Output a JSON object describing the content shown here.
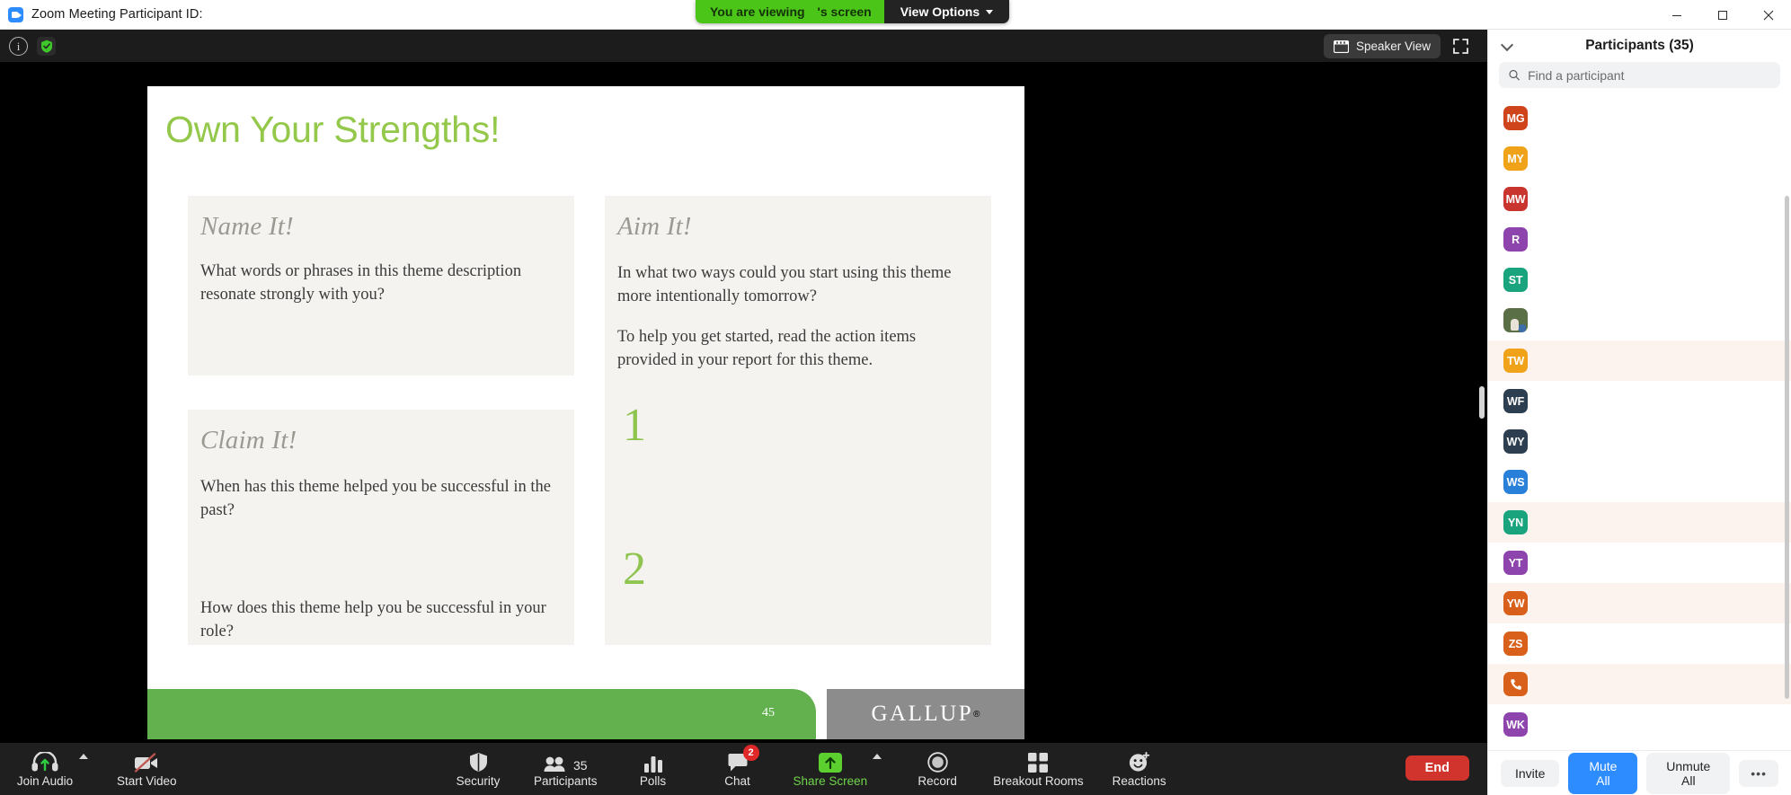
{
  "titlebar": {
    "app_title": "Zoom Meeting Participant ID:",
    "logo_icon": "zoom-logo-icon",
    "minimize_icon": "minimize-icon",
    "maximize_icon": "maximize-icon",
    "close_icon": "close-icon"
  },
  "share_banner": {
    "viewing_label": "You are viewing",
    "screen_owner_label": "'s screen",
    "view_options_label": "View Options",
    "caret_icon": "chevron-down-icon",
    "green": "#4bc517"
  },
  "meeting_top": {
    "info_icon": "info-icon",
    "encryption_icon": "shield-check-icon",
    "speaker_view_label": "Speaker View",
    "speaker_view_icon": "grid-view-icon",
    "fullscreen_icon": "fullscreen-expand-icon"
  },
  "slide": {
    "title": "Own Your Strengths!",
    "title_color": "#94c84b",
    "cards": [
      {
        "heading": "Name It!",
        "paragraphs": [
          "What words or phrases in this theme description resonate strongly with you?"
        ]
      },
      {
        "heading": "Claim It!",
        "paragraphs": [
          "When has this theme helped you be successful in the past?",
          "How does this theme help you be successful in your role?"
        ]
      },
      {
        "heading": "Aim It!",
        "paragraphs": [
          "In what two ways could you start using this theme more intentionally tomorrow?",
          "To help you get started, read the action items provided in your report for this theme."
        ],
        "numbers": [
          "1",
          "2"
        ]
      }
    ],
    "page_number": "45",
    "brand": "GALLUP",
    "brand_mark": "®",
    "footer_color": "#62b14e",
    "logo_block_color": "#8c8c8c"
  },
  "bottombar": {
    "left": [
      {
        "label": "Join Audio",
        "icon": "headset-join-audio-icon",
        "has_caret": true
      },
      {
        "label": "Start Video",
        "icon": "video-off-icon",
        "has_caret": false
      }
    ],
    "center": [
      {
        "label": "Security",
        "icon": "shield-icon"
      },
      {
        "label": "Participants",
        "icon": "participants-icon",
        "count": "35"
      },
      {
        "label": "Polls",
        "icon": "poll-bars-icon"
      },
      {
        "label": "Chat",
        "icon": "chat-bubble-icon",
        "badge": "2"
      },
      {
        "label": "Share Screen",
        "icon": "share-screen-icon",
        "has_caret": true,
        "green": true
      },
      {
        "label": "Record",
        "icon": "record-circle-icon"
      },
      {
        "label": "Breakout Rooms",
        "icon": "breakout-rooms-icon"
      },
      {
        "label": "Reactions",
        "icon": "reactions-smiley-icon"
      }
    ],
    "end_label": "End",
    "end_color": "#d0342c"
  },
  "panel": {
    "title": "Participants (35)",
    "collapse_icon": "chevron-down-icon",
    "search": {
      "placeholder": "Find a participant",
      "value": "",
      "icon": "search-icon"
    },
    "participants": [
      {
        "initials": "MG",
        "color": "#d0441b",
        "type": "initials",
        "highlight": false
      },
      {
        "initials": "MY",
        "color": "#f0a219",
        "type": "initials",
        "highlight": false
      },
      {
        "initials": "MW",
        "color": "#c9352e",
        "type": "initials",
        "highlight": false
      },
      {
        "initials": "R",
        "color": "#8e44ad",
        "type": "initials",
        "highlight": false
      },
      {
        "initials": "ST",
        "color": "#1aa47e",
        "type": "initials",
        "highlight": false
      },
      {
        "initials": "",
        "color": "#5b6f47",
        "type": "photo",
        "highlight": false
      },
      {
        "initials": "TW",
        "color": "#f0a219",
        "type": "initials",
        "highlight": true
      },
      {
        "initials": "WF",
        "color": "#2c3e50",
        "type": "initials",
        "highlight": false
      },
      {
        "initials": "WY",
        "color": "#2c3e50",
        "type": "initials",
        "highlight": false
      },
      {
        "initials": "WS",
        "color": "#2980d9",
        "type": "initials",
        "highlight": false
      },
      {
        "initials": "YN",
        "color": "#1aa47e",
        "type": "initials",
        "highlight": true
      },
      {
        "initials": "YT",
        "color": "#8e44ad",
        "type": "initials",
        "highlight": false
      },
      {
        "initials": "YW",
        "color": "#d9601a",
        "type": "initials",
        "highlight": true
      },
      {
        "initials": "ZS",
        "color": "#d9601a",
        "type": "initials",
        "highlight": false
      },
      {
        "initials": "",
        "color": "#d9601a",
        "type": "phone",
        "highlight": true
      },
      {
        "initials": "WK",
        "color": "#8e44ad",
        "type": "initials",
        "highlight": false
      }
    ],
    "footer": {
      "invite_label": "Invite",
      "mute_all_label": "Mute All",
      "unmute_all_label": "Unmute All",
      "more_label": "•••",
      "primary_color": "#2d8cff"
    }
  }
}
